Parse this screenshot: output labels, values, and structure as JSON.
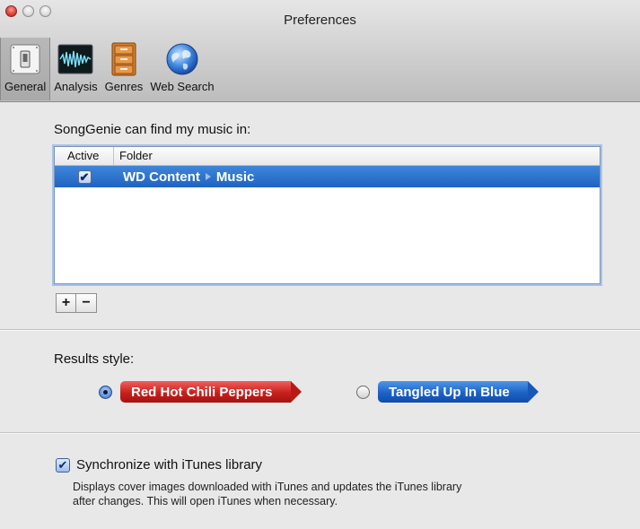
{
  "window": {
    "title": "Preferences"
  },
  "toolbar": {
    "items": [
      {
        "label": "General",
        "icon": "general-switch-icon",
        "selected": true
      },
      {
        "label": "Analysis",
        "icon": "waveform-icon",
        "selected": false
      },
      {
        "label": "Genres",
        "icon": "drawer-cabinet-icon",
        "selected": false
      },
      {
        "label": "Web Search",
        "icon": "globe-icon",
        "selected": false
      }
    ]
  },
  "folders": {
    "heading": "SongGenie can find my music in:",
    "columns": {
      "active": "Active",
      "folder": "Folder"
    },
    "rows": [
      {
        "active": true,
        "path": [
          "WD Content",
          "Music"
        ]
      }
    ],
    "add_label": "+",
    "remove_label": "−"
  },
  "results": {
    "heading": "Results style:",
    "options": [
      {
        "label": "Red Hot Chili Peppers",
        "selected": true,
        "color": "#c8201c"
      },
      {
        "label": "Tangled Up In Blue",
        "selected": false,
        "color": "#1b62c6"
      }
    ]
  },
  "sync": {
    "label": "Synchronize with iTunes library",
    "checked": true,
    "description_line1": "Displays cover images downloaded with iTunes and updates the iTunes library",
    "description_line2": "after changes. This will open iTunes when necessary."
  },
  "colors": {
    "selection": "#2a6fd0",
    "window_bg": "#e8e8e8"
  }
}
